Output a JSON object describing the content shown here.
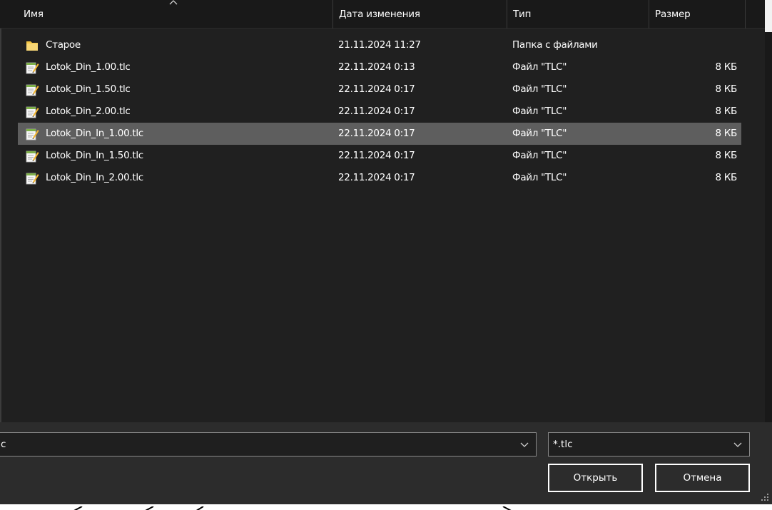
{
  "columns": {
    "name": "Имя",
    "date": "Дата изменения",
    "type": "Тип",
    "size": "Размер"
  },
  "files": [
    {
      "icon": "folder-icon",
      "name": "Старое",
      "date": "21.11.2024 11:27",
      "type": "Папка с файлами",
      "size": ""
    },
    {
      "icon": "text-file-icon",
      "name": "Lotok_Din_1.00.tlc",
      "date": "22.11.2024 0:13",
      "type": "Файл \"TLC\"",
      "size": "8 КБ"
    },
    {
      "icon": "text-file-icon",
      "name": "Lotok_Din_1.50.tlc",
      "date": "22.11.2024 0:17",
      "type": "Файл \"TLC\"",
      "size": "8 КБ"
    },
    {
      "icon": "text-file-icon",
      "name": "Lotok_Din_2.00.tlc",
      "date": "22.11.2024 0:17",
      "type": "Файл \"TLC\"",
      "size": "8 КБ"
    },
    {
      "icon": "text-file-icon",
      "name": "Lotok_Din_In_1.00.tlc",
      "date": "22.11.2024 0:17",
      "type": "Файл \"TLC\"",
      "size": "8 КБ",
      "selected": true
    },
    {
      "icon": "text-file-icon",
      "name": "Lotok_Din_In_1.50.tlc",
      "date": "22.11.2024 0:17",
      "type": "Файл \"TLC\"",
      "size": "8 КБ"
    },
    {
      "icon": "text-file-icon",
      "name": "Lotok_Din_In_2.00.tlc",
      "date": "22.11.2024 0:17",
      "type": "Файл \"TLC\"",
      "size": "8 КБ"
    }
  ],
  "filename_field": {
    "value": "c"
  },
  "filter_field": {
    "value": "*.tlc"
  },
  "buttons": {
    "open": "Открыть",
    "cancel": "Отмена"
  },
  "colors": {
    "background": "#202020",
    "header": "#191919",
    "selected_row": "#5e5e5e",
    "bottom_panel": "#2c2c2c"
  }
}
